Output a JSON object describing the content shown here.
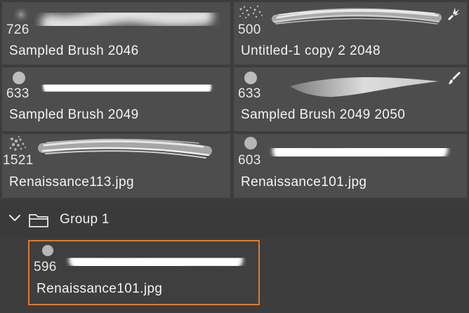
{
  "colors": {
    "tile_bg": "#4d4d4d",
    "panel_bg": "#3d3d3d",
    "selection": "#e07a2d"
  },
  "brushes": [
    {
      "size": "726",
      "name": "Sampled Brush 2046",
      "tool_icon": null
    },
    {
      "size": "500",
      "name": "Untitled-1 copy 2 2048",
      "tool_icon": "fan-brush-icon"
    },
    {
      "size": "633",
      "name": "Sampled Brush 2049",
      "tool_icon": null
    },
    {
      "size": "633",
      "name": "Sampled Brush 2049 2050",
      "tool_icon": "paintbrush-icon"
    },
    {
      "size": "1521",
      "name": "Renaissance113.jpg",
      "tool_icon": null
    },
    {
      "size": "603",
      "name": "Renaissance101.jpg",
      "tool_icon": null
    }
  ],
  "group": {
    "label": "Group 1",
    "expanded": true,
    "brushes": [
      {
        "size": "596",
        "name": "Renaissance101.jpg",
        "selected": true
      }
    ]
  }
}
